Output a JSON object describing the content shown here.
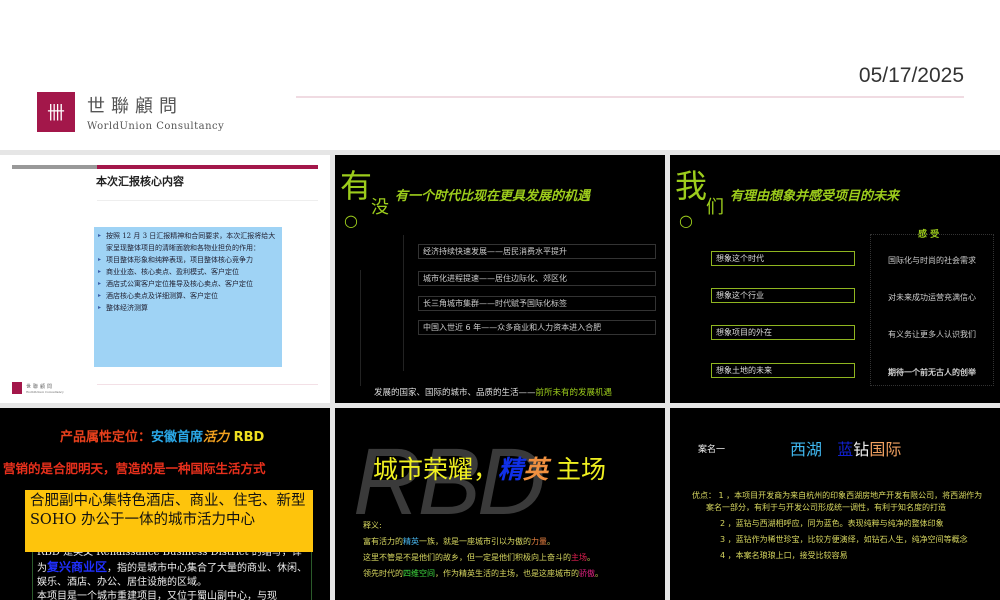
{
  "header": {
    "date": "05/17/2025",
    "logo_cn": "世聯顧問",
    "logo_en": "WorldUnion Consultancy"
  },
  "slides": [
    {
      "title": "本次汇报核心内容",
      "bullets": [
        "按照 12 月 3 日汇报精神和合同要求，本次汇报将给大家呈现整体项目的清晰面貌和各物业担负的作用：",
        "项目整体形象和纯粹表现，项目整体核心竞争力",
        "商业业态、核心卖点、盈利模式、客户定位",
        "酒店式公寓客户定位推导及核心卖点、客户定位",
        "酒店核心卖点及详细测算、客户定位",
        "整体经济测算"
      ],
      "logo_cn": "世聯顧問",
      "logo_en": "WorldUnion Consultancy"
    },
    {
      "big1": "有",
      "big2": "没",
      "big3": "○",
      "title": "有一个时代比现在更具发展的机遇",
      "items": [
        "经济持续快速发展——居民消费水平提升",
        "城市化进程提速——居住边际化、郊区化",
        "长三角城市集群——时代赋予国际化标签",
        "中国入世近 6 年——众多商业和人力资本进入合肥"
      ],
      "footer_a": "发展的国家、国际的城市、品质的生活——",
      "footer_b": "前所未有的发展机遇"
    },
    {
      "big1": "我",
      "big2": "们",
      "big3": "○",
      "title": "有理由想象并感受项目的未来",
      "feel_title": "感 受",
      "items": [
        "想象这个时代",
        "想象这个行业",
        "想象项目的外在",
        "想象土地的未来"
      ],
      "feelings": [
        "国际化与时尚的社会需求",
        "对未来成功运营充满信心",
        "有义务让更多人认识我们",
        "期待一个前无古人的创举"
      ]
    },
    {
      "line1_a": "产品属性定位：",
      "line1_b": "安徽首席",
      "line1_c": "活力",
      "line1_d": "RBD",
      "line2": "营销的是合肥明天，营造的是一种国际生活方式",
      "yellow_box": "合肥副中心集特色酒店、商业、住宅、新型 SOHO 办公于一体的城市活力中心",
      "p1_a": "RBD 是英文 Renaissance Business District 的缩写，译为",
      "p1_b": "复兴商业区",
      "p1_c": "，指的是城市中心集合了大量的商业、休闲、娱乐、酒店、办公、居住设施的区域。",
      "p2": "本项目是一个城市重建项目，又位于蜀山副中心，与现"
    },
    {
      "watermark": "RBD",
      "title_a": "城市荣耀，",
      "title_b": "精",
      "title_c": "英",
      "title_d": " 主场",
      "label": "释义:",
      "l1": [
        "富有活力的",
        "精英",
        "一族，就是一座城市引以为傲的",
        "力量",
        "。"
      ],
      "l2": [
        "这里不管是不是他们的故乡，但一定是他们积极向上奋斗的",
        "主场",
        "。"
      ],
      "l3": [
        "领先时代的",
        "四维空间",
        "，作为精英生活的主场，也是这座城市的",
        "骄傲",
        "。"
      ]
    },
    {
      "label": "案名一",
      "name_a": "西湖",
      "name_b": "蓝",
      "name_c": "钻",
      "name_d": "国际",
      "p1": "优点： 1 ，本项目开发商为来自杭州的印象西湖房地产开发有限公司，将西湖作为案名一部分，有利于与开发公司形成统一调性，有利于知名度的打造",
      "p2": "2 ，蓝钻与西湖相呼应，同为蓝色。表现纯粹与纯净的整体印象",
      "p3": "3 ，蓝钻作为稀世珍宝，比较方便演绎，如钻石人生，纯净空间等概念",
      "p4": "4 ，本案名琅琅上口，接受比较容易"
    }
  ]
}
